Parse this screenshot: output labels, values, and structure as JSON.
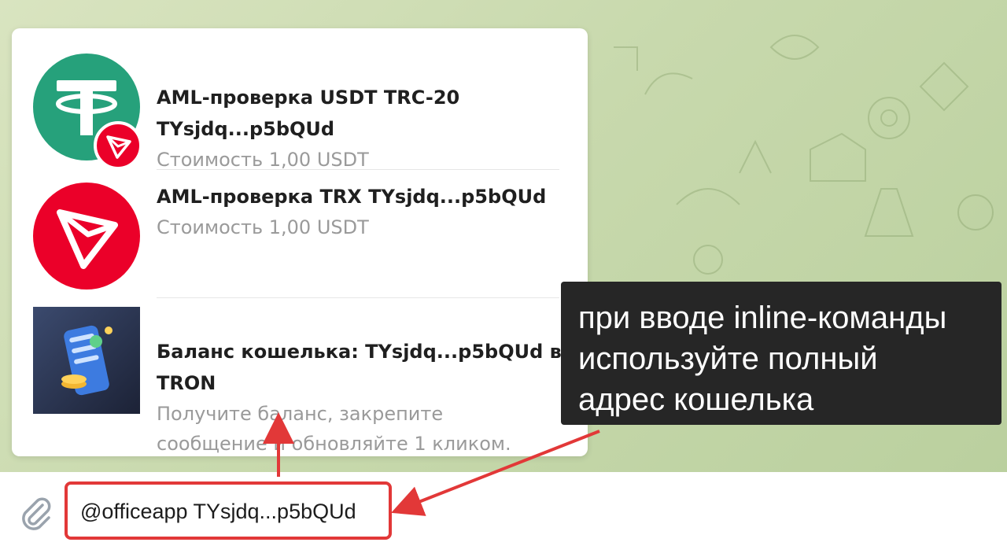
{
  "results": [
    {
      "title_line1": "AML-проверка USDT TRC-20",
      "title_line2": "TYsjdq...p5bQUd",
      "subtitle": "Стоимость 1,00 USDT",
      "thumb_icon": "tether-icon",
      "badge_icon": "tron-icon"
    },
    {
      "title_line1": "AML-проверка TRX TYsjdq...p5bQUd",
      "subtitle": "Стоимость 1,00 USDT",
      "thumb_icon": "tron-icon"
    },
    {
      "title_line1": "Баланс кошелька: TYsjdq...p5bQUd в",
      "title_line2": "TRON",
      "subtitle_line1": "Получите баланс, закрепите",
      "subtitle_line2": "сообщение и обновляйте 1 кликом.",
      "thumb_icon": "wallet-balance-icon"
    }
  ],
  "input": {
    "value": "@officeapp TYsjdq...p5bQUd",
    "attach_icon": "paperclip-icon"
  },
  "annotation": {
    "line1": "при вводе inline-команды",
    "line2": "используйте полный",
    "line3": "адрес кошелька"
  },
  "colors": {
    "tether_green": "#26a17b",
    "tron_red": "#eb0029",
    "highlight_red": "#e23838",
    "callout_bg": "#262626"
  }
}
